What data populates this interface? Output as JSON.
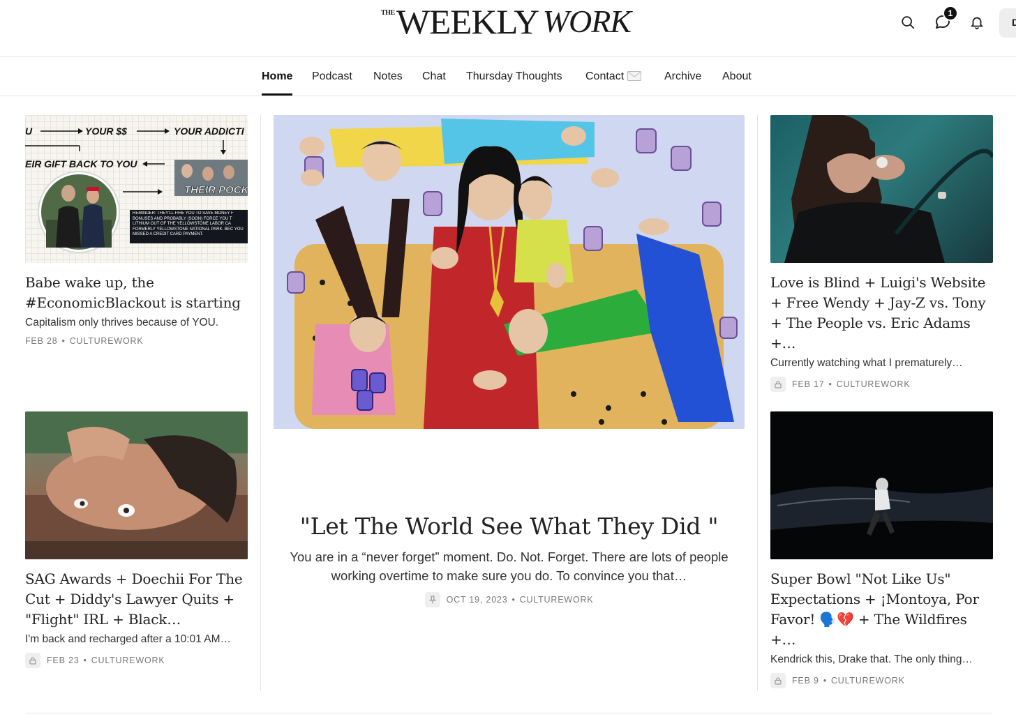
{
  "header": {
    "logo": {
      "the": "THE",
      "weekly": "WEEKLY",
      "work": "WORK"
    },
    "notification_count": "1",
    "account_initial": "D"
  },
  "nav": {
    "items": [
      {
        "label": "Home",
        "active": true
      },
      {
        "label": "Podcast"
      },
      {
        "label": "Notes"
      },
      {
        "label": "Chat"
      },
      {
        "label": "Thursday Thoughts"
      },
      {
        "label": "Contact"
      },
      {
        "label": "Archive"
      },
      {
        "label": "About"
      }
    ]
  },
  "posts": {
    "top_left": {
      "title": "Babe wake up, the #EconomicBlackout is starting",
      "subtitle": "Capitalism only thrives because of YOU.",
      "date": "FEB 28",
      "author": "CULTUREWORK",
      "locked": false,
      "thumb_text": {
        "your_money": "YOUR $$",
        "your_addiction": "YOUR ADDICTI",
        "you": "U",
        "gift_back": "EIR GIFT BACK TO YOU",
        "their_pocket": "THEIR POCK",
        "reminder": "REMINDER: THEY'LL FIRE YOU TO SAVE MONEY F BONUSES AND PROBABLY (SOON) FORCE YOU T LITHIUM OUT OF THE YELLOWSTONE LABOR CA FORMERLY YELLOWSTONE NATIONAL PARK. BEC YOU MISSED A CREDIT CARD PAYMENT."
      }
    },
    "bottom_left": {
      "title": "SAG Awards + Doechii For The Cut + Diddy's Lawyer Quits + \"Flight\" IRL + Black…",
      "subtitle": "I'm back and recharged after a 10:01 AM…",
      "date": "FEB 23",
      "author": "CULTUREWORK",
      "locked": true
    },
    "featured": {
      "title": "\"Let The World See What They Did \"",
      "subtitle": "You are in a “never forget” moment. Do. Not. Forget. There are lots of people working overtime to make sure you do. To convince you that…",
      "date": "OCT 19, 2023",
      "author": "CULTUREWORK",
      "pinned": true
    },
    "top_right": {
      "title": "Love is Blind + Luigi's Website + Free Wendy + Jay-Z vs. Tony + The People vs. Eric Adams +…",
      "subtitle": "Currently watching what I prematurely…",
      "date": "FEB 17",
      "author": "CULTUREWORK",
      "locked": true
    },
    "bottom_right": {
      "title": "Super Bowl \"Not Like Us\" Expectations + ¡Montoya, Por Favor! 🗣️💔 + The Wildfires +…",
      "subtitle": "Kendrick this, Drake that. The only thing…",
      "date": "FEB 9",
      "author": "CULTUREWORK",
      "locked": true
    }
  },
  "meta_separator": "•",
  "colors": {
    "text": "#1a1a1a",
    "muted": "#777777",
    "divider": "#e4e4e4"
  }
}
